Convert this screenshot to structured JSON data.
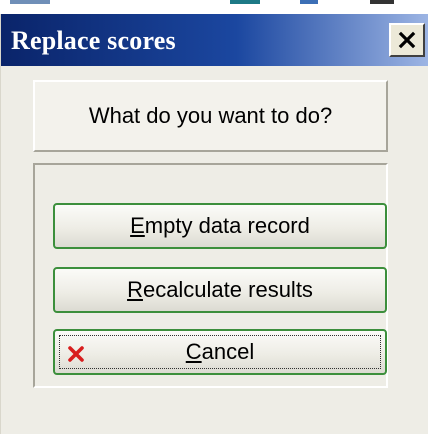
{
  "dialog": {
    "title": "Replace scores",
    "close_label": "×"
  },
  "question": "What do you want to do?",
  "buttons": {
    "empty": {
      "mnemonic": "E",
      "rest": "mpty data record"
    },
    "recalc": {
      "mnemonic": "R",
      "rest": "ecalculate results"
    },
    "cancel": {
      "mnemonic": "C",
      "rest": "ancel",
      "icon": "x-icon"
    }
  },
  "colors": {
    "titlebar_start": "#0a246a",
    "titlebar_end": "#9db5e4",
    "button_border": "#3c8f3c",
    "cancel_icon": "#d81e1e"
  }
}
